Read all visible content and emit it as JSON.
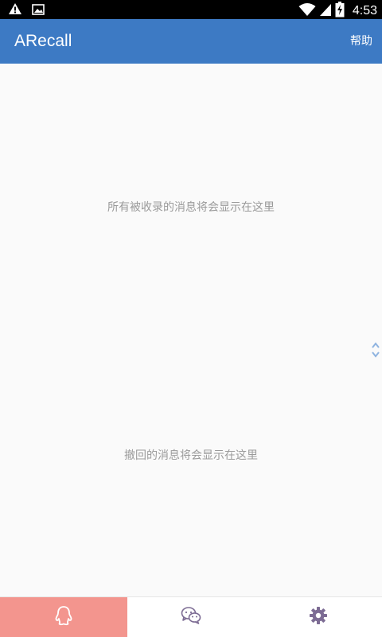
{
  "status_bar": {
    "icons_left": [
      "warning-icon",
      "image-icon"
    ],
    "icons_right": [
      "wifi-icon",
      "cell-signal-icon",
      "battery-charging-icon"
    ],
    "time": "4:53"
  },
  "app_bar": {
    "title": "ARecall",
    "help_label": "帮助",
    "color": "#3d7ac4"
  },
  "main": {
    "all_messages_empty_text": "所有被收录的消息将会显示在这里",
    "recalled_messages_empty_text": "撤回的消息将会显示在这里",
    "scroll_handle_icon": "chevron-up-down-icon"
  },
  "bottom_nav": {
    "active_color": "#f3958e",
    "tabs": [
      {
        "icon": "qq-penguin-icon",
        "active": true
      },
      {
        "icon": "wechat-icon",
        "active": false
      },
      {
        "icon": "gear-icon",
        "active": false
      }
    ]
  }
}
